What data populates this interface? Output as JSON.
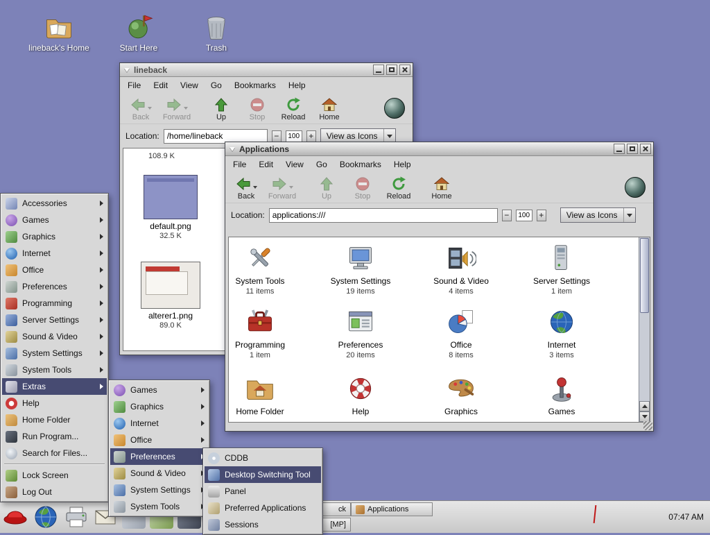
{
  "colors": {
    "desktop_background": "#7d82b8",
    "menu_highlight": "#474b72",
    "window_chrome": "#d6d6d6"
  },
  "desktop": {
    "icons": [
      {
        "label": "lineback's Home",
        "icon": "home-folder-icon"
      },
      {
        "label": "Start Here",
        "icon": "start-here-icon"
      },
      {
        "label": "Trash",
        "icon": "trash-icon"
      }
    ]
  },
  "lineback_window": {
    "title": "lineback",
    "menu": [
      "File",
      "Edit",
      "View",
      "Go",
      "Bookmarks",
      "Help"
    ],
    "toolbar": [
      "Back",
      "Forward",
      "Up",
      "Stop",
      "Reload",
      "Home"
    ],
    "location_label": "Location:",
    "location_value": "/home/lineback",
    "zoom_minus": "−",
    "zoom_value": "100",
    "zoom_plus": "+",
    "view_as": "View as Icons",
    "size_header": "108.9 K",
    "files": [
      {
        "name": "default.png",
        "size": "32.5 K"
      },
      {
        "name": "alterer1.png",
        "size": "89.0 K"
      }
    ]
  },
  "applications_window": {
    "title": "Applications",
    "menu": [
      "File",
      "Edit",
      "View",
      "Go",
      "Bookmarks",
      "Help"
    ],
    "toolbar": [
      "Back",
      "Forward",
      "Up",
      "Stop",
      "Reload",
      "Home"
    ],
    "location_label": "Location:",
    "location_value": "applications:///",
    "zoom_minus": "−",
    "zoom_value": "100",
    "zoom_plus": "+",
    "view_as": "View as Icons",
    "items": [
      {
        "label": "System Tools",
        "count": "11 items",
        "icon": "system-tools-icon"
      },
      {
        "label": "System Settings",
        "count": "19 items",
        "icon": "system-settings-icon"
      },
      {
        "label": "Sound & Video",
        "count": "4 items",
        "icon": "sound-video-icon"
      },
      {
        "label": "Server Settings",
        "count": "1 item",
        "icon": "server-settings-icon"
      },
      {
        "label": "Programming",
        "count": "1 item",
        "icon": "programming-icon"
      },
      {
        "label": "Preferences",
        "count": "20 items",
        "icon": "preferences-icon"
      },
      {
        "label": "Office",
        "count": "8 items",
        "icon": "office-icon"
      },
      {
        "label": "Internet",
        "count": "3 items",
        "icon": "internet-icon"
      },
      {
        "label": "Home Folder",
        "count": "",
        "icon": "home-folder-icon"
      },
      {
        "label": "Help",
        "count": "",
        "icon": "help-icon"
      },
      {
        "label": "Graphics",
        "count": "",
        "icon": "graphics-icon"
      },
      {
        "label": "Games",
        "count": "",
        "icon": "games-icon"
      }
    ]
  },
  "main_menu": {
    "items": [
      {
        "label": "Accessories",
        "icon": "accessories-icon",
        "submenu": true
      },
      {
        "label": "Games",
        "icon": "games-icon",
        "submenu": true
      },
      {
        "label": "Graphics",
        "icon": "graphics-icon",
        "submenu": true
      },
      {
        "label": "Internet",
        "icon": "internet-icon",
        "submenu": true
      },
      {
        "label": "Office",
        "icon": "office-icon",
        "submenu": true
      },
      {
        "label": "Preferences",
        "icon": "preferences-icon",
        "submenu": true
      },
      {
        "label": "Programming",
        "icon": "programming-icon",
        "submenu": true
      },
      {
        "label": "Server Settings",
        "icon": "server-settings-icon",
        "submenu": true
      },
      {
        "label": "Sound & Video",
        "icon": "sound-video-icon",
        "submenu": true
      },
      {
        "label": "System Settings",
        "icon": "system-settings-icon",
        "submenu": true
      },
      {
        "label": "System Tools",
        "icon": "system-tools-icon",
        "submenu": true
      },
      {
        "label": "Extras",
        "icon": "extras-icon",
        "submenu": true,
        "highlighted": true
      },
      {
        "label": "Help",
        "icon": "help-icon"
      },
      {
        "label": "Home Folder",
        "icon": "home-folder-icon"
      },
      {
        "label": "Run Program...",
        "icon": "run-program-icon"
      },
      {
        "label": "Search for Files...",
        "icon": "search-icon"
      },
      {
        "label": "Lock Screen",
        "icon": "lock-screen-icon"
      },
      {
        "label": "Log Out",
        "icon": "log-out-icon"
      }
    ]
  },
  "extras_menu": {
    "items": [
      {
        "label": "Games",
        "icon": "games-icon",
        "submenu": true
      },
      {
        "label": "Graphics",
        "icon": "graphics-icon",
        "submenu": true
      },
      {
        "label": "Internet",
        "icon": "internet-icon",
        "submenu": true
      },
      {
        "label": "Office",
        "icon": "office-icon",
        "submenu": true
      },
      {
        "label": "Preferences",
        "icon": "preferences-icon",
        "submenu": true,
        "highlighted": true
      },
      {
        "label": "Sound & Video",
        "icon": "sound-video-icon",
        "submenu": true
      },
      {
        "label": "System Settings",
        "icon": "system-settings-icon",
        "submenu": true
      },
      {
        "label": "System Tools",
        "icon": "system-tools-icon",
        "submenu": true
      }
    ]
  },
  "preferences_menu": {
    "items": [
      {
        "label": "CDDB",
        "icon": "cddb-icon"
      },
      {
        "label": "Desktop Switching Tool",
        "icon": "desktop-switching-icon",
        "highlighted": true
      },
      {
        "label": "Panel",
        "icon": "panel-icon"
      },
      {
        "label": "Preferred Applications",
        "icon": "preferred-apps-icon"
      },
      {
        "label": "Sessions",
        "icon": "sessions-icon"
      }
    ]
  },
  "panel": {
    "taskbar_row1": [
      {
        "label": "ck"
      },
      {
        "label": "Applications"
      }
    ],
    "taskbar_row2": [
      {
        "label": "[MP]"
      }
    ],
    "clock": "07:47 AM"
  }
}
